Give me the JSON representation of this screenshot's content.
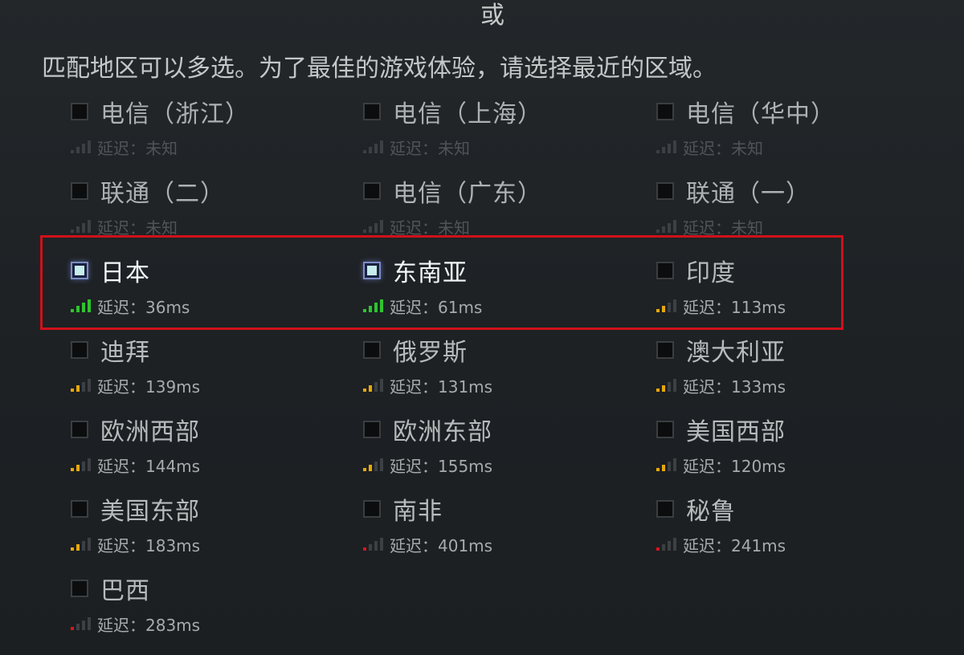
{
  "header": {
    "or_label": "或",
    "instruction": "匹配地区可以多选。为了最佳的游戏体验，请选择最近的区域。"
  },
  "colors": {
    "signal_good": "#2ec42e",
    "signal_medium": "#e8a80c",
    "signal_poor": "#d8151c",
    "signal_off": "#3c4043",
    "highlight": "#d0101a"
  },
  "regions": [
    {
      "name": "电信（浙江）",
      "latency": "延迟：未知",
      "checked": false,
      "bars": 0,
      "quality": "unknown"
    },
    {
      "name": "电信（上海）",
      "latency": "延迟：未知",
      "checked": false,
      "bars": 0,
      "quality": "unknown"
    },
    {
      "name": "电信（华中）",
      "latency": "延迟：未知",
      "checked": false,
      "bars": 0,
      "quality": "unknown"
    },
    {
      "name": "联通（二）",
      "latency": "延迟：未知",
      "checked": false,
      "bars": 0,
      "quality": "unknown"
    },
    {
      "name": "电信（广东）",
      "latency": "延迟：未知",
      "checked": false,
      "bars": 0,
      "quality": "unknown"
    },
    {
      "name": "联通（一）",
      "latency": "延迟：未知",
      "checked": false,
      "bars": 0,
      "quality": "unknown"
    },
    {
      "name": "日本",
      "latency": "延迟：36ms",
      "checked": true,
      "bars": 4,
      "quality": "good"
    },
    {
      "name": "东南亚",
      "latency": "延迟：61ms",
      "checked": true,
      "bars": 4,
      "quality": "good"
    },
    {
      "name": "印度",
      "latency": "延迟：113ms",
      "checked": false,
      "bars": 2,
      "quality": "medium"
    },
    {
      "name": "迪拜",
      "latency": "延迟：139ms",
      "checked": false,
      "bars": 2,
      "quality": "medium"
    },
    {
      "name": "俄罗斯",
      "latency": "延迟：131ms",
      "checked": false,
      "bars": 2,
      "quality": "medium"
    },
    {
      "name": "澳大利亚",
      "latency": "延迟：133ms",
      "checked": false,
      "bars": 2,
      "quality": "medium"
    },
    {
      "name": "欧洲西部",
      "latency": "延迟：144ms",
      "checked": false,
      "bars": 2,
      "quality": "medium"
    },
    {
      "name": "欧洲东部",
      "latency": "延迟：155ms",
      "checked": false,
      "bars": 2,
      "quality": "medium"
    },
    {
      "name": "美国西部",
      "latency": "延迟：120ms",
      "checked": false,
      "bars": 2,
      "quality": "medium"
    },
    {
      "name": "美国东部",
      "latency": "延迟：183ms",
      "checked": false,
      "bars": 2,
      "quality": "medium"
    },
    {
      "name": "南非",
      "latency": "延迟：401ms",
      "checked": false,
      "bars": 1,
      "quality": "poor"
    },
    {
      "name": "秘鲁",
      "latency": "延迟：241ms",
      "checked": false,
      "bars": 1,
      "quality": "poor"
    },
    {
      "name": "巴西",
      "latency": "延迟：283ms",
      "checked": false,
      "bars": 1,
      "quality": "poor"
    }
  ]
}
